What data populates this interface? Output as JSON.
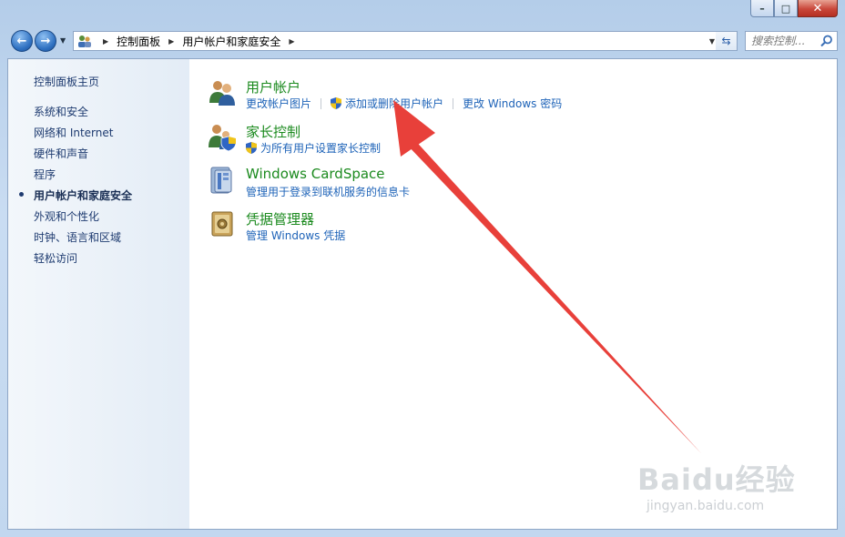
{
  "window": {
    "caption": {
      "minimize": "–",
      "maximize": "□",
      "close": "✕"
    }
  },
  "nav": {
    "back": "←",
    "forward": "→",
    "breadcrumbs": [
      "控制面板",
      "用户帐户和家庭安全"
    ],
    "search_placeholder": "搜索控制..."
  },
  "sidebar": {
    "items": [
      {
        "label": "控制面板主页",
        "active": false
      },
      {
        "label": "系统和安全",
        "active": false
      },
      {
        "label": "网络和 Internet",
        "active": false
      },
      {
        "label": "硬件和声音",
        "active": false
      },
      {
        "label": "程序",
        "active": false
      },
      {
        "label": "用户帐户和家庭安全",
        "active": true
      },
      {
        "label": "外观和个性化",
        "active": false
      },
      {
        "label": "时钟、语言和区域",
        "active": false
      },
      {
        "label": "轻松访问",
        "active": false
      }
    ]
  },
  "categories": [
    {
      "title": "用户帐户",
      "icon": "users-icon",
      "links": [
        {
          "label": "更改帐户图片",
          "shield": false
        },
        {
          "label": "添加或删除用户帐户",
          "shield": true
        },
        {
          "label": "更改 Windows 密码",
          "shield": false
        }
      ]
    },
    {
      "title": "家长控制",
      "icon": "parental-controls-icon",
      "links": [
        {
          "label": "为所有用户设置家长控制",
          "shield": true
        }
      ]
    },
    {
      "title": "Windows CardSpace",
      "icon": "cardspace-icon",
      "links": [
        {
          "label": "管理用于登录到联机服务的信息卡",
          "shield": false
        }
      ]
    },
    {
      "title": "凭据管理器",
      "icon": "credential-manager-icon",
      "links": [
        {
          "label": "管理 Windows 凭据",
          "shield": false
        }
      ]
    }
  ],
  "watermark": {
    "brand": "Baidu经验",
    "site": "jingyan.baidu.com"
  },
  "colors": {
    "link": "#1e63b8",
    "category_title": "#1b8a1e",
    "arrow": "#e8403a"
  }
}
